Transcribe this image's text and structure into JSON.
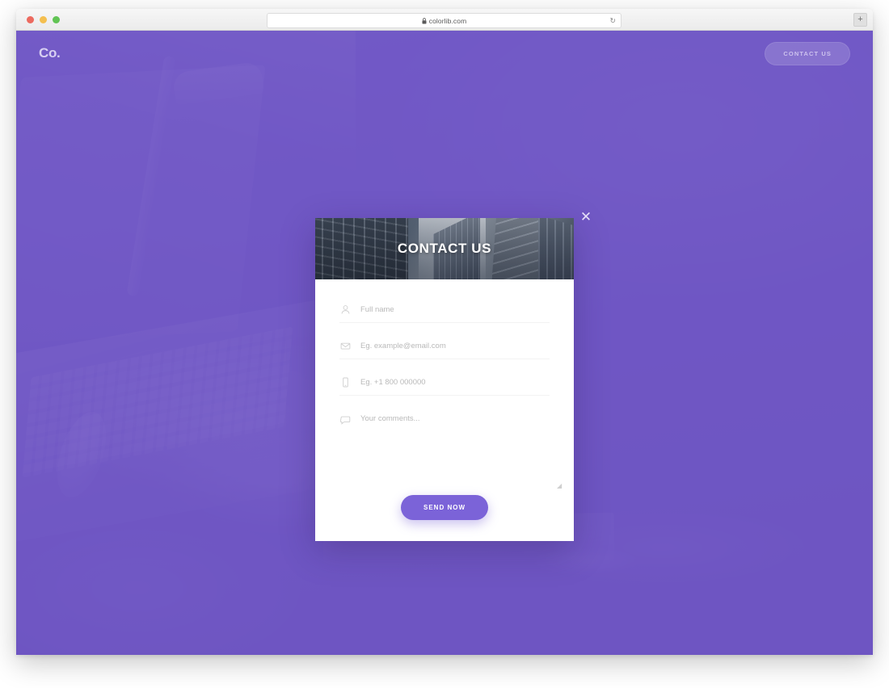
{
  "browser": {
    "url": "colorlib.com",
    "lock_icon": "lock-icon",
    "reload_icon": "↻",
    "new_tab_icon": "+",
    "traffic_lights": [
      "close",
      "minimize",
      "zoom"
    ]
  },
  "site": {
    "logo": "Co.",
    "nav": {
      "contact_label": "CONTACT US"
    },
    "theme": {
      "brand_purple": "#7055c5",
      "accent_button": "#7b63d8",
      "logo_color": "#d8d0f2",
      "nav_button_text": "#cdc2ee"
    },
    "background": {
      "description": "laptop on a desk",
      "overlay_color": "rgba(112, 85, 197, 0.78)"
    }
  },
  "modal": {
    "close_icon": "✕",
    "hero": {
      "title": "CONTACT US",
      "image_description": "skyscrapers seen from below"
    },
    "fields": [
      {
        "name": "full-name",
        "icon": "user-icon",
        "placeholder": "Full name",
        "value": ""
      },
      {
        "name": "email",
        "icon": "envelope-icon",
        "placeholder": "Eg. example@email.com",
        "value": ""
      },
      {
        "name": "phone",
        "icon": "phone-icon",
        "placeholder": "Eg. +1 800 000000",
        "value": ""
      },
      {
        "name": "comments",
        "icon": "comment-icon",
        "placeholder": "Your comments...",
        "value": ""
      }
    ],
    "submit_label": "SEND NOW",
    "resize_grip": "◢"
  }
}
